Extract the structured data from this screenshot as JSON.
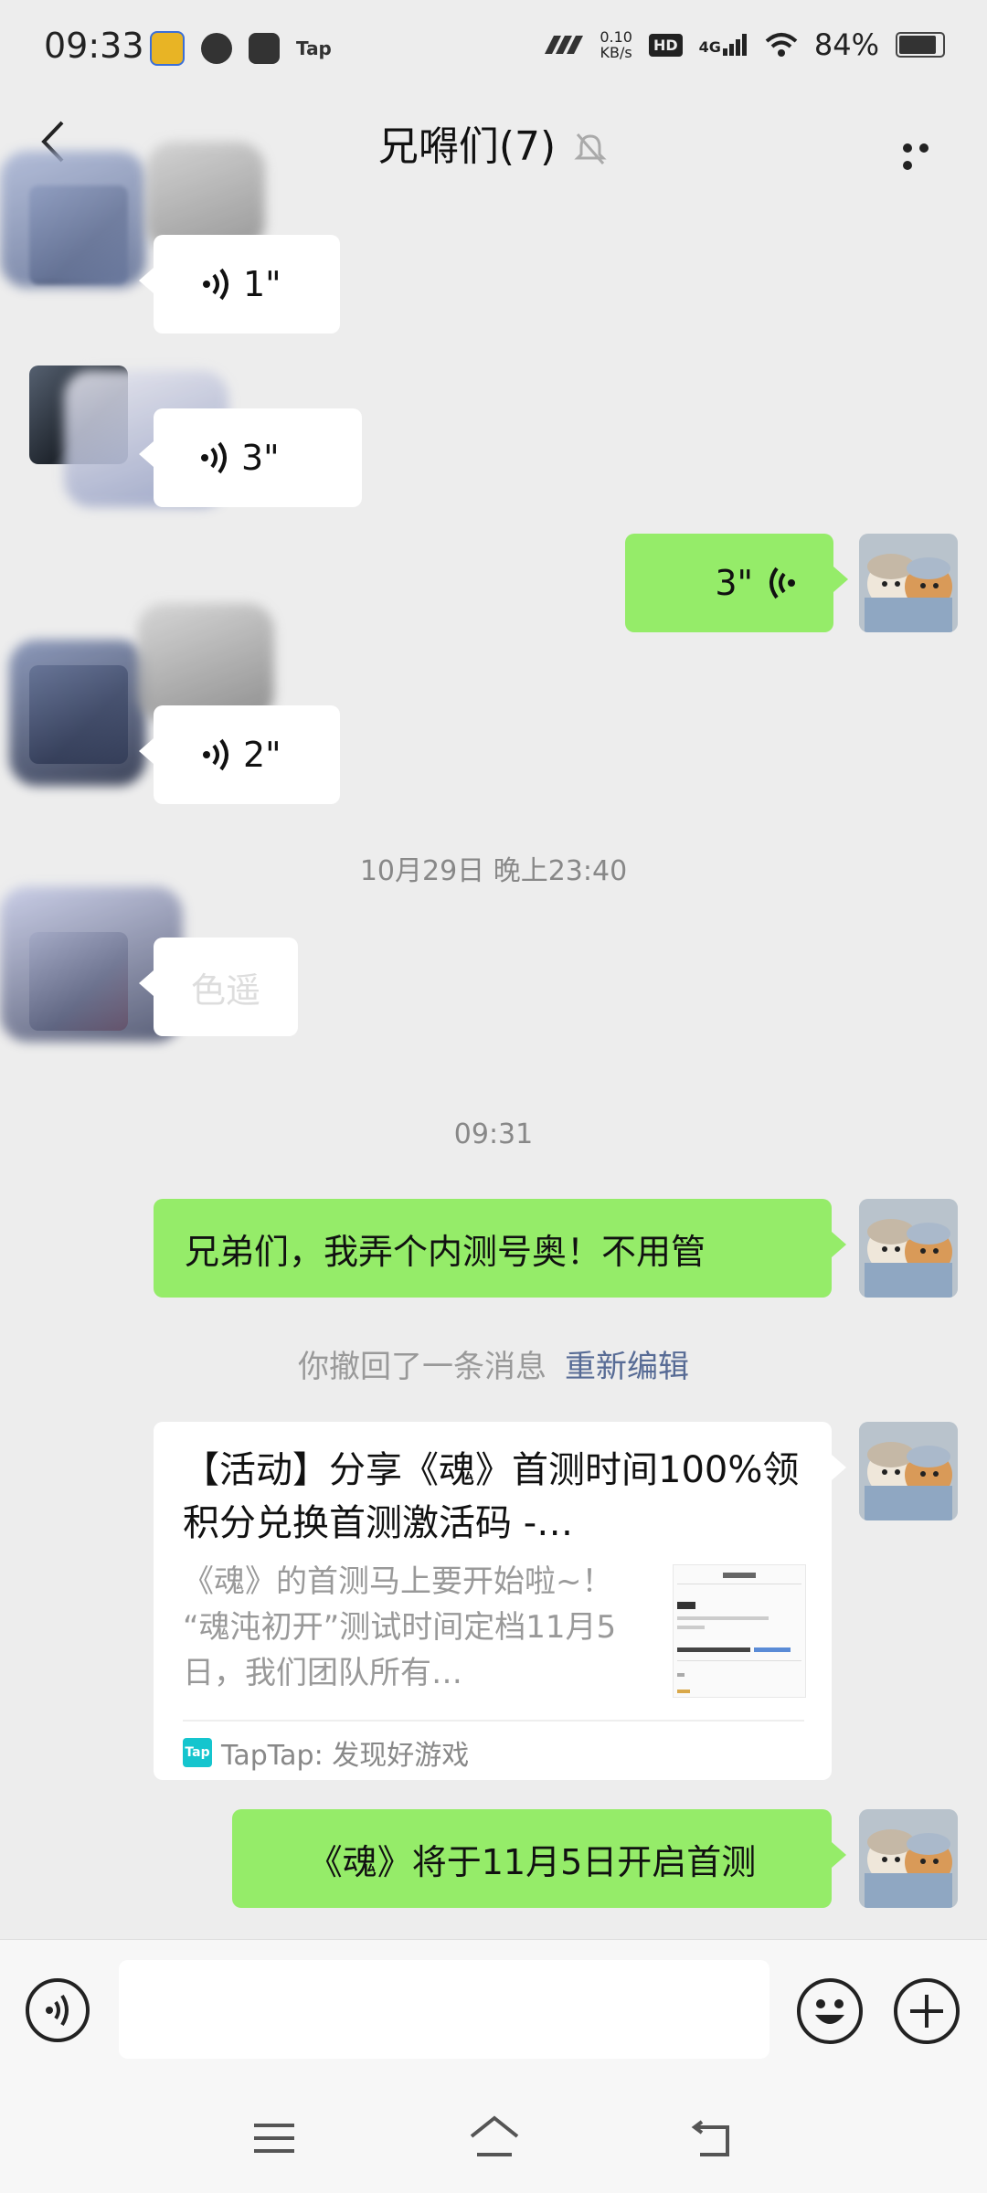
{
  "status_bar": {
    "time": "09:33",
    "app_icons": [
      "qq-music-icon",
      "speedometer-icon",
      "inbox-icon"
    ],
    "tap_label": "Tap",
    "net_speed_value": "0.10",
    "net_speed_unit": "KB/s",
    "hd_label": "HD",
    "signal_label": "4G",
    "battery": "84%"
  },
  "header": {
    "title": "兄嘚们(7)",
    "muted": true
  },
  "messages": {
    "m1_voice": "1\"",
    "m2_voice": "3\"",
    "m3_voice": "3\"",
    "m4_voice": "2\"",
    "timestamp_1": "10月29日 晚上23:40",
    "m5_text": "色遥",
    "timestamp_2": "09:31",
    "m6_text": "兄弟们，我弄个内测号奥！不用管",
    "recall_text": "你撤回了一条消息",
    "recall_action": "重新编辑",
    "card": {
      "title": "【活动】分享《魂》首测时间100%领积分兑换首测激活码 -…",
      "description": "《魂》的首测马上要开始啦~！ “魂沌初开”测试时间定档11月5日，我们团队所有…",
      "source_logo": "Tap",
      "source": "TapTap: 发现好游戏"
    },
    "m7_text": "《魂》将于11月5日开启首测"
  },
  "input": {
    "placeholder": ""
  },
  "colors": {
    "background": "#ededed",
    "bubble_self": "#95ec69",
    "bubble_other": "#ffffff",
    "link": "#576b95"
  }
}
